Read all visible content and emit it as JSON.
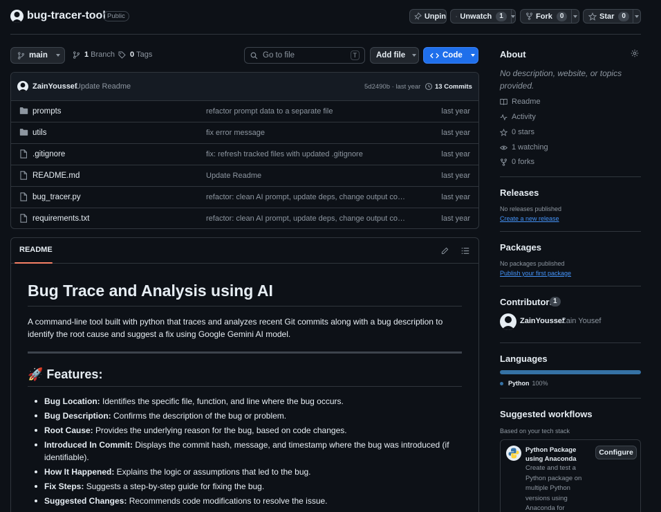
{
  "repo": {
    "name": "bug-tracer-tool",
    "visibility": "Public"
  },
  "header_actions": {
    "unpin": "Unpin",
    "unwatch": "Unwatch",
    "watch_count": "1",
    "fork": "Fork",
    "fork_count": "0",
    "star": "Star",
    "star_count": "0"
  },
  "toolbar": {
    "branch": "main",
    "branch_count": "1",
    "branch_label": "Branch",
    "tag_count": "0",
    "tag_label": "Tags",
    "go_to_file_placeholder": "Go to file",
    "go_to_file_key": "T",
    "add_file": "Add file",
    "code": "Code"
  },
  "latest_commit": {
    "author": "ZainYoussef",
    "message": "Update Readme",
    "hash_time": "5d2490b · last year",
    "commits": "13 Commits"
  },
  "files": [
    {
      "name": "prompts",
      "type": "folder",
      "message": "refactor prompt data to a separate file",
      "time": "last year"
    },
    {
      "name": "utils",
      "type": "folder",
      "message": "fix error message",
      "time": "last year"
    },
    {
      "name": ".gitignore",
      "type": "file",
      "message": "fix: refresh tracked files with updated .gitignore",
      "time": "last year"
    },
    {
      "name": "README.md",
      "type": "file",
      "message": "Update Readme",
      "time": "last year"
    },
    {
      "name": "bug_tracer.py",
      "type": "file",
      "message": "refactor: clean AI prompt, update deps, change output colori...",
      "time": "last year"
    },
    {
      "name": "requirements.txt",
      "type": "file",
      "message": "refactor: clean AI prompt, update deps, change output colori...",
      "time": "last year"
    }
  ],
  "readme": {
    "tab": "README",
    "title": "Bug Trace and Analysis using AI",
    "intro": "A command-line tool built with python that traces and analyzes recent Git commits along with a bug description to identify the root cause and suggest a fix using Google Gemini AI model.",
    "features_heading": "🚀 Features:",
    "features": [
      {
        "label": "Bug Location:",
        "text": " Identifies the specific file, function, and line where the bug occurs."
      },
      {
        "label": "Bug Description:",
        "text": " Confirms the description of the bug or problem."
      },
      {
        "label": "Root Cause:",
        "text": " Provides the underlying reason for the bug, based on code changes."
      },
      {
        "label": "Introduced In Commit:",
        "text": " Displays the commit hash, message, and timestamp where the bug was introduced (if identifiable)."
      },
      {
        "label": "How It Happened:",
        "text": " Explains the logic or assumptions that led to the bug."
      },
      {
        "label": "Fix Steps:",
        "text": " Suggests a step-by-step guide for fixing the bug."
      },
      {
        "label": "Suggested Changes:",
        "text": " Recommends code modifications to resolve the issue."
      }
    ]
  },
  "about": {
    "heading": "About",
    "description": "No description, website, or topics provided.",
    "readme": "Readme",
    "activity": "Activity",
    "stars": "0 stars",
    "watching": "1 watching",
    "forks": "0 forks"
  },
  "releases": {
    "heading": "Releases",
    "none": "No releases published",
    "link": "Create a new release"
  },
  "packages": {
    "heading": "Packages",
    "none": "No packages published",
    "link": "Publish your first package"
  },
  "contributors": {
    "heading": "Contributors",
    "count": "1",
    "login": "ZainYoussef",
    "name": "Zain Yousef"
  },
  "languages": {
    "heading": "Languages",
    "items": [
      {
        "name": "Python",
        "percent": "100%",
        "fraction": 1.0,
        "color": "#3572A5"
      }
    ]
  },
  "workflows": {
    "heading": "Suggested workflows",
    "sub": "Based on your tech stack",
    "card_title": "Python Package using Anaconda",
    "configure": "Configure",
    "card_desc": "Create and test a Python package on multiple Python versions using Anaconda for package"
  },
  "colors": {
    "accent": "#238636",
    "code_button": "#1f6feb",
    "link": "#4493f8",
    "tab_underline": "#f78166"
  }
}
